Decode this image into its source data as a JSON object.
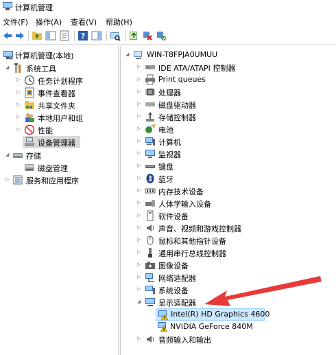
{
  "window": {
    "title": "计算机管理"
  },
  "menu": [
    "文件(F)",
    "操作(A)",
    "查看(V)",
    "帮助(H)"
  ],
  "left_tree": {
    "root": "计算机管理(本地)",
    "system_tools": "系统工具",
    "task_scheduler": "任务计划程序",
    "event_viewer": "事件查看器",
    "shared_folders": "共享文件夹",
    "local_users": "本地用户和组",
    "performance": "性能",
    "device_manager": "设备管理器",
    "storage": "存储",
    "disk_mgmt": "磁盘管理",
    "services": "服务和应用程序"
  },
  "device_tree": {
    "computer_name": "WIN-T8FPJA0UMUU",
    "categories": [
      "IDE ATA/ATAPI 控制器",
      "Print queues",
      "处理器",
      "磁盘驱动器",
      "存储控制器",
      "电池",
      "计算机",
      "监视器",
      "键盘",
      "蓝牙",
      "内存技术设备",
      "人体学输入设备",
      "软件设备",
      "声音、视频和游戏控制器",
      "鼠标和其他指针设备",
      "通用串行总线控制器",
      "图像设备",
      "网络适配器",
      "系统设备",
      "显示适配器"
    ],
    "display_children": [
      "Intel(R) HD Graphics 4600",
      "NVIDIA GeForce 840M"
    ],
    "last_category": "音频输入和输出"
  },
  "colors": {
    "arrow": "#e83a3a",
    "highlight": "#cce8ff",
    "selected": "#d9d9d9"
  }
}
